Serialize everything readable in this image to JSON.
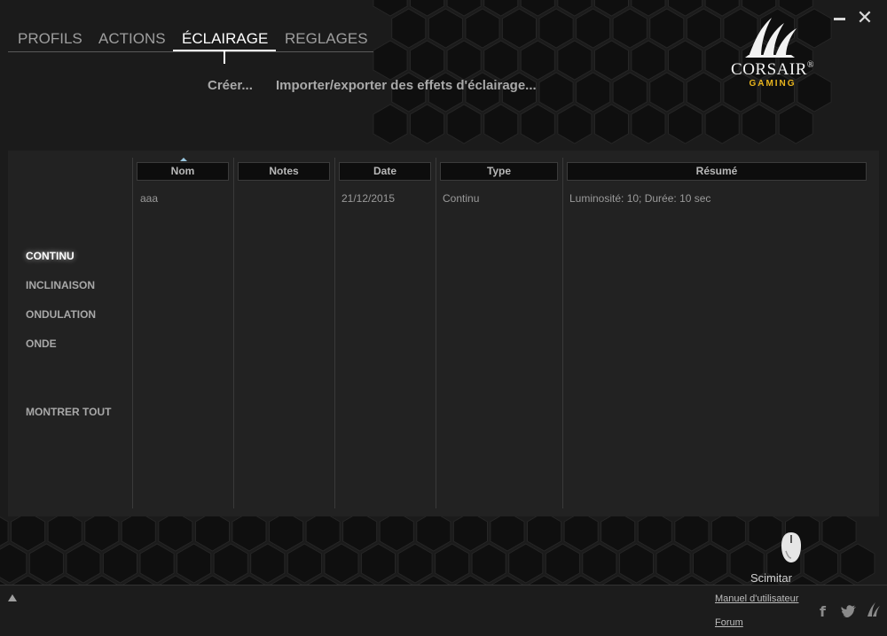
{
  "window": {
    "minimize_icon": "minimize-icon",
    "close_icon": "close-icon",
    "close_glyph": "✕"
  },
  "tabs": [
    {
      "label": "PROFILS",
      "active": false
    },
    {
      "label": "ACTIONS",
      "active": false
    },
    {
      "label": "ÉCLAIRAGE",
      "active": true
    },
    {
      "label": "REGLAGES",
      "active": false
    }
  ],
  "sub_actions": {
    "create": "Créer...",
    "import_export": "Importer/exporter des effets d'éclairage..."
  },
  "logo": {
    "name": "CORSAIR",
    "registered": "®",
    "sub": "GAMING",
    "name_color": "#f2f2f2",
    "sub_color": "#e9b51e"
  },
  "sidebar": {
    "items": [
      {
        "label": "CONTINU",
        "active": true
      },
      {
        "label": "INCLINAISON",
        "active": false
      },
      {
        "label": "ONDULATION",
        "active": false
      },
      {
        "label": "ONDE",
        "active": false
      }
    ],
    "show_all": "MONTRER TOUT"
  },
  "table": {
    "columns": [
      "Nom",
      "Notes",
      "Date",
      "Type",
      "Résumé"
    ],
    "sort_column": "Nom",
    "rows": [
      {
        "nom": "aaa",
        "notes": "",
        "date": "21/12/2015",
        "type": "Continu",
        "resume": "Luminosité: 10; Durée: 10 sec"
      }
    ]
  },
  "device": {
    "name": "Scimitar",
    "icon": "mouse-icon"
  },
  "footer": {
    "manual_link": "Manuel d'utilisateur",
    "forum_link": "Forum",
    "social_icons": [
      "facebook-icon",
      "twitter-icon",
      "corsair-icon"
    ],
    "social_glyphs": {
      "facebook": "f",
      "twitter": "🐦"
    }
  },
  "colors": {
    "accent_logo": "#e9b51e",
    "panel_bg": "#222222",
    "active_text": "#ffffff"
  }
}
